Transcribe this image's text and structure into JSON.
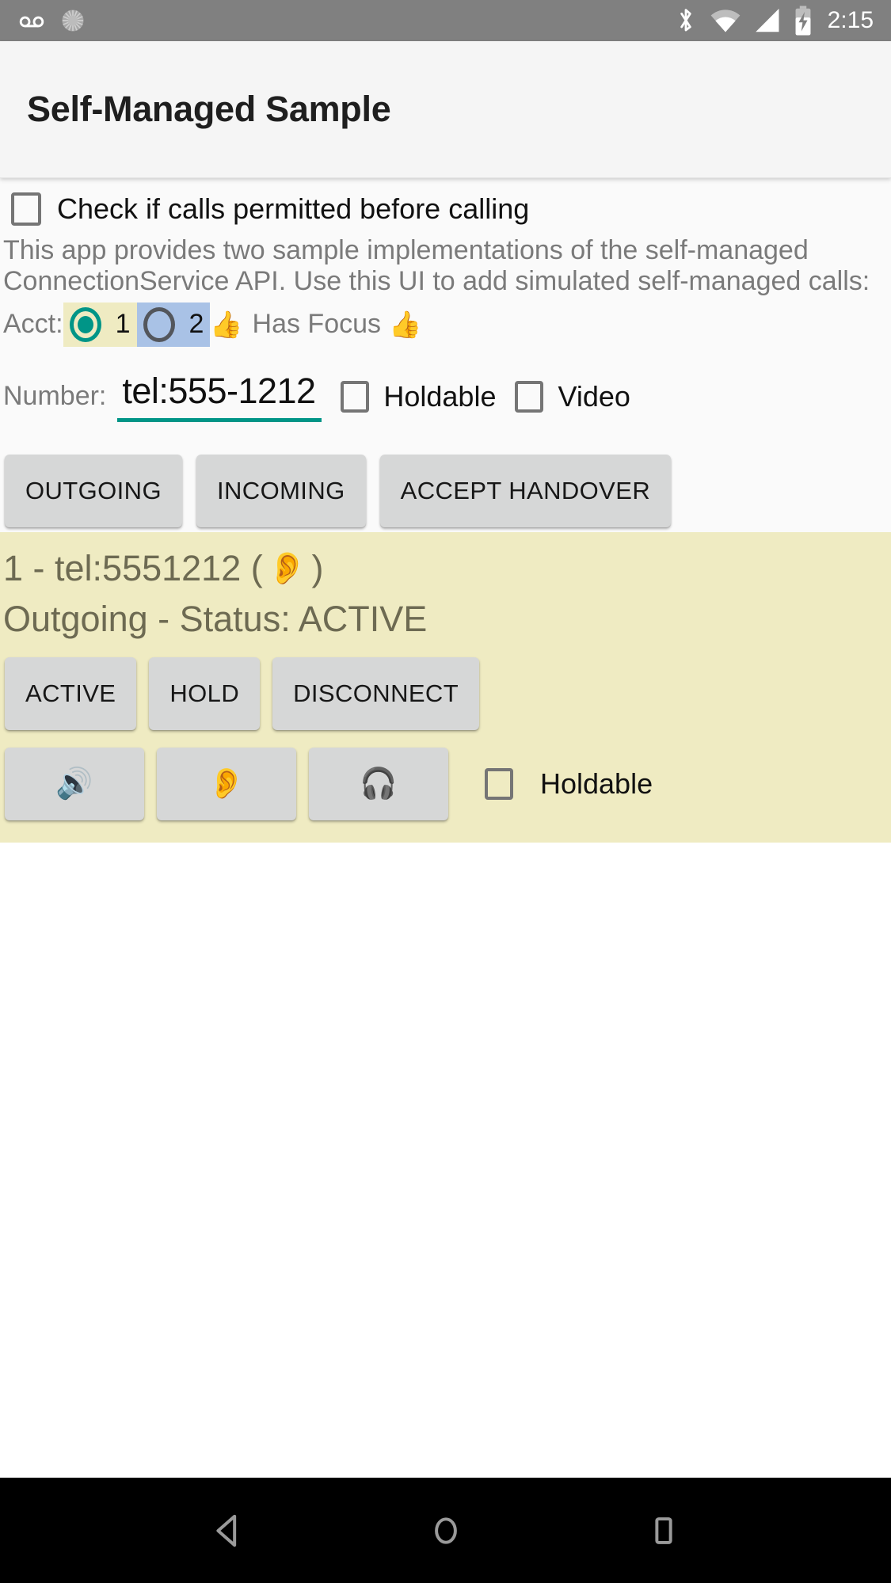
{
  "status_bar": {
    "icons_left": [
      "voicemail-icon",
      "sync-spinner-icon"
    ],
    "icons_right": [
      "bluetooth-icon",
      "wifi-icon",
      "cell-signal-icon",
      "battery-charging-icon"
    ],
    "clock": "2:15",
    "background_color": "#808080",
    "foreground_color": "#ffffff"
  },
  "app_bar": {
    "title": "Self-Managed Sample"
  },
  "permission_check": {
    "label": "Check if calls permitted before calling",
    "checked": false
  },
  "description": "This app provides two sample implementations of the self-managed ConnectionService API.  Use this UI to add simulated self-managed calls:",
  "account_row": {
    "label": "Acct:",
    "options": [
      {
        "value": "1",
        "selected": true,
        "highlight_color": "#efebc2"
      },
      {
        "value": "2",
        "selected": false,
        "highlight_color": "#a9c2e6"
      }
    ],
    "focus_emoji_left": "👍",
    "focus_label": "Has Focus",
    "focus_emoji_right": "👍"
  },
  "number_row": {
    "label": "Number:",
    "value": "tel:555-1212",
    "placeholder": "tel:555-1212",
    "underline_color": "#009587",
    "holdable": {
      "label": "Holdable",
      "checked": false
    },
    "video": {
      "label": "Video",
      "checked": false
    }
  },
  "main_actions": [
    {
      "label": "OUTGOING",
      "name": "outgoing-button"
    },
    {
      "label": "INCOMING",
      "name": "incoming-button"
    },
    {
      "label": "ACCEPT HANDOVER",
      "name": "accept-handover-button"
    }
  ],
  "call_card": {
    "background_color": "#efebc2",
    "text_color": "#6d6a52",
    "line1_prefix": "1 - tel:5551212 (",
    "line1_emoji": "👂",
    "line1_suffix": ")",
    "line2": "Outgoing - Status: ACTIVE",
    "state_buttons": [
      {
        "label": "ACTIVE",
        "name": "call-active-button"
      },
      {
        "label": "HOLD",
        "name": "call-hold-button"
      },
      {
        "label": "DISCONNECT",
        "name": "call-disconnect-button"
      }
    ],
    "audio_buttons": [
      {
        "label": "🔊",
        "name": "audio-speaker-button"
      },
      {
        "label": "👂",
        "name": "audio-earpiece-button"
      },
      {
        "label": "🎧",
        "name": "audio-headset-button"
      }
    ],
    "holdable": {
      "label": "Holdable",
      "checked": false
    }
  },
  "nav_bar": {
    "back": "back-nav-button",
    "home": "home-nav-button",
    "recents": "recents-nav-button",
    "background_color": "#000000"
  }
}
